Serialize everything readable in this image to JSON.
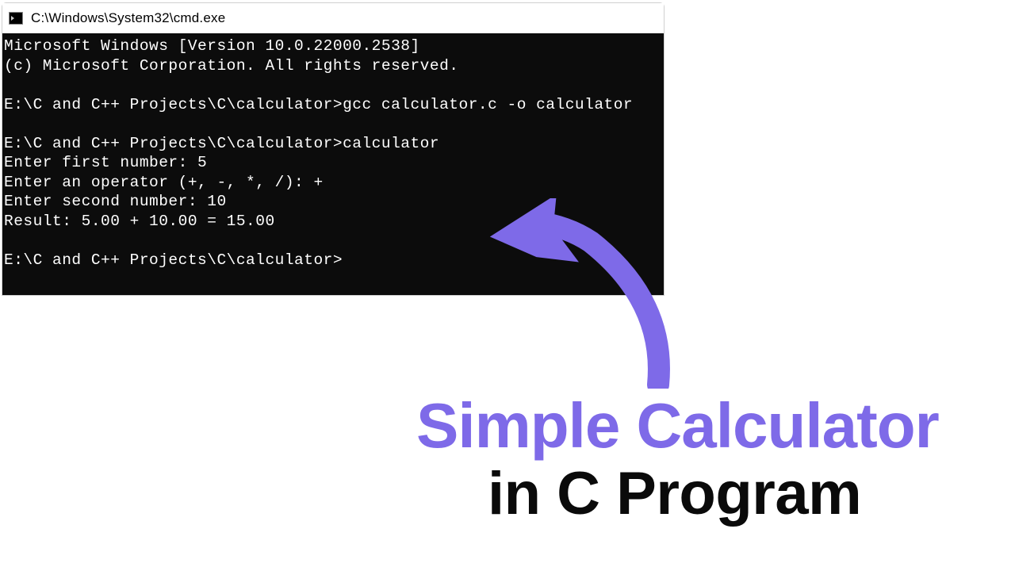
{
  "window": {
    "title": "C:\\Windows\\System32\\cmd.exe"
  },
  "terminal": {
    "lines": [
      "Microsoft Windows [Version 10.0.22000.2538]",
      "(c) Microsoft Corporation. All rights reserved.",
      "",
      "E:\\C and C++ Projects\\C\\calculator>gcc calculator.c -o calculator",
      "",
      "E:\\C and C++ Projects\\C\\calculator>calculator",
      "Enter first number: 5",
      "Enter an operator (+, -, *, /): +",
      "Enter second number: 10",
      "Result: 5.00 + 10.00 = 15.00",
      "",
      "E:\\C and C++ Projects\\C\\calculator>"
    ]
  },
  "annotation": {
    "heading_line1": "Simple Calculator",
    "heading_line2": "in C Program",
    "arrow_color": "#7E6AE8"
  }
}
